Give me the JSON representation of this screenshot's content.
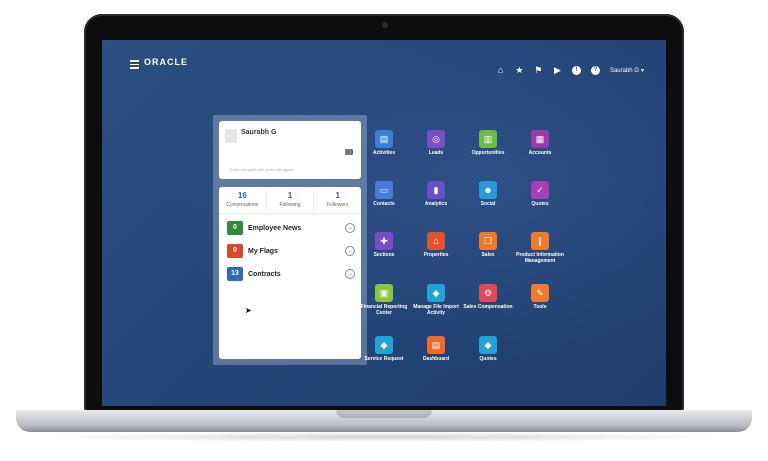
{
  "header": {
    "logo_text": "ORACLE",
    "user_name": "Saurabh G",
    "user_caret": "▾"
  },
  "social": {
    "name": "Saurabh G",
    "share_placeholder": "Share thoughts with your colleagues",
    "stats": [
      {
        "count": "16",
        "label": "Conversations"
      },
      {
        "count": "1",
        "label": "Following"
      },
      {
        "count": "1",
        "label": "Followers"
      }
    ],
    "rows": [
      {
        "count": "0",
        "label": "Employee News",
        "color": "#2e8b3d"
      },
      {
        "count": "0",
        "label": "My Flags",
        "color": "#d9482b"
      },
      {
        "count": "13",
        "label": "Contracts",
        "color": "#2f6db3"
      }
    ]
  },
  "apps": [
    {
      "label": "Activities",
      "icon": "clipboard-icon",
      "color": "#3b7fd1"
    },
    {
      "label": "Leads",
      "icon": "target-icon",
      "color": "#7b4fc4"
    },
    {
      "label": "Opportunities",
      "icon": "chart-icon",
      "color": "#6cbb45"
    },
    {
      "label": "Accounts",
      "icon": "building-icon",
      "color": "#9e3aa8"
    },
    {
      "label": "Contacts",
      "icon": "contact-card-icon",
      "color": "#4b7bd4"
    },
    {
      "label": "Analytics",
      "icon": "bar-chart-icon",
      "color": "#6b4fc7"
    },
    {
      "label": "Social",
      "icon": "people-icon",
      "color": "#2a9ad6"
    },
    {
      "label": "Quotes",
      "icon": "check-doc-icon",
      "color": "#a53fb5"
    },
    {
      "label": "Sections",
      "icon": "puzzle-icon",
      "color": "#7b4fc4"
    },
    {
      "label": "Properties",
      "icon": "bank-icon",
      "color": "#e0532c"
    },
    {
      "label": "Sales",
      "icon": "copy-icon",
      "color": "#f07a2c"
    },
    {
      "label": "Product Information Management",
      "icon": "barcode-icon",
      "color": "#f07a2c"
    },
    {
      "label": "Financial Reporting Center",
      "icon": "report-icon",
      "color": "#8dc63f"
    },
    {
      "label": "Manage File Import Activity",
      "icon": "cube-icon",
      "color": "#21a3d6"
    },
    {
      "label": "Sales Compensation",
      "icon": "gear-chart-icon",
      "color": "#e04a5a"
    },
    {
      "label": "Tools",
      "icon": "tools-icon",
      "color": "#f07a2c"
    },
    {
      "label": "Service Request",
      "icon": "cube-icon",
      "color": "#21a3d6"
    },
    {
      "label": "Dashboard",
      "icon": "dashboard-icon",
      "color": "#f06a2c"
    },
    {
      "label": "Quotes",
      "icon": "cube-icon",
      "color": "#21a3d6"
    }
  ]
}
